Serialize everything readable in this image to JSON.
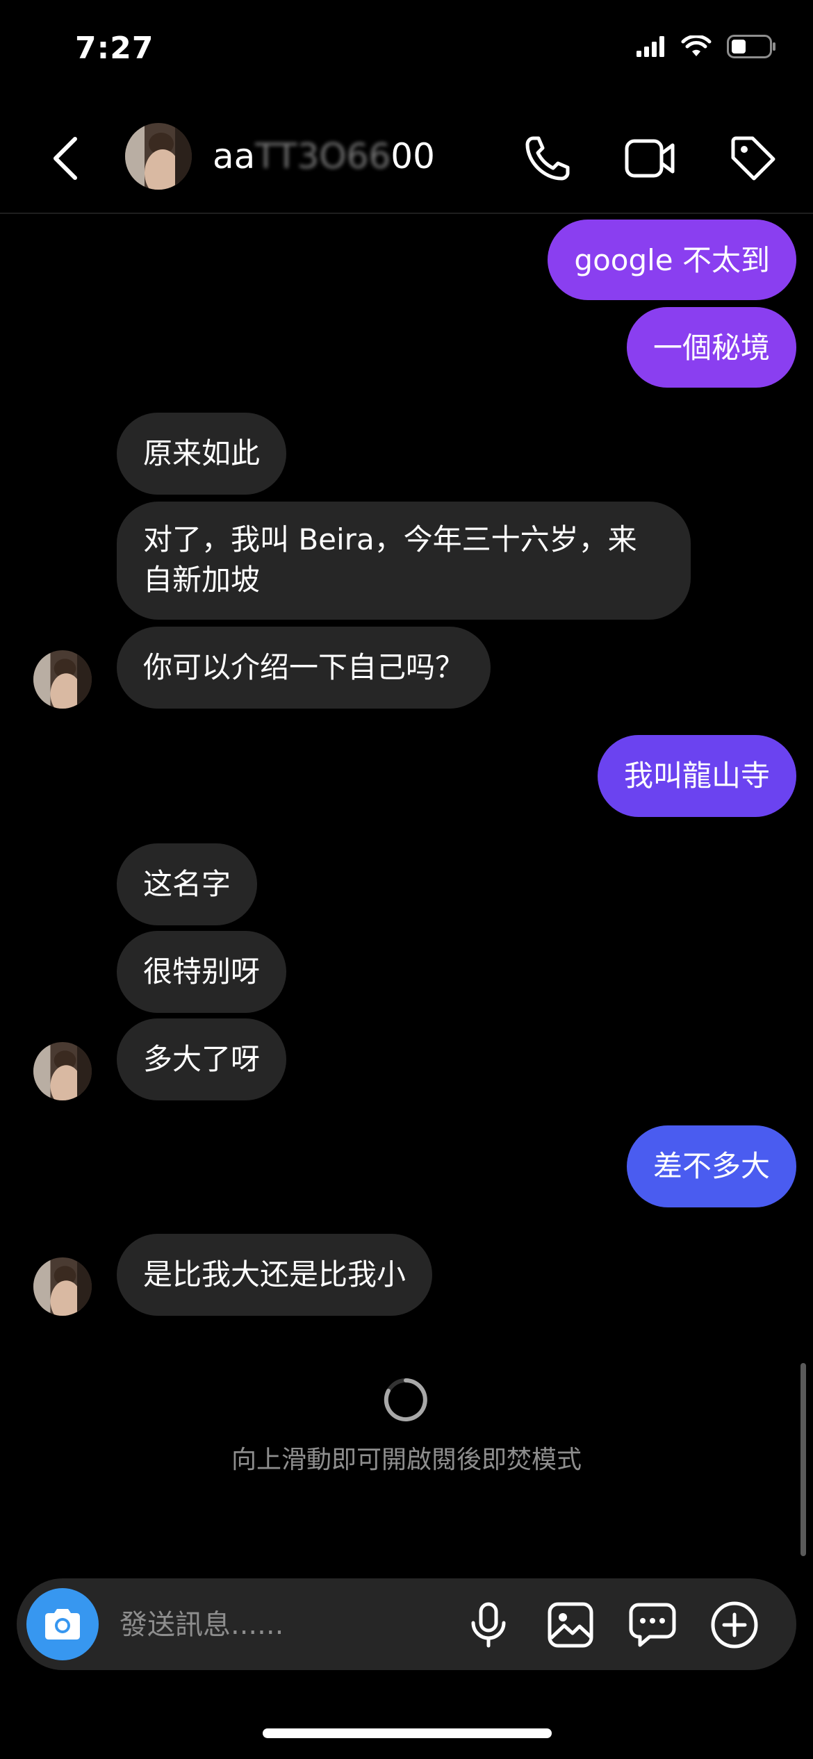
{
  "status": {
    "time": "7:27"
  },
  "header": {
    "name_visible_prefix": "aa",
    "name_obscured": "TT3O66",
    "name_visible_suffix": "00"
  },
  "messages": [
    {
      "side": "out",
      "text": "google 不太到",
      "color": "#8a3ff0"
    },
    {
      "side": "out",
      "text": "一個秘境",
      "color": "#8a3ff0"
    },
    {
      "side": "in",
      "text": "原来如此"
    },
    {
      "side": "in",
      "text": "对了，我叫 Beira，今年三十六岁，来自新加坡"
    },
    {
      "side": "in",
      "text": "你可以介绍一下自己吗？"
    },
    {
      "side": "out",
      "text": "我叫龍山寺",
      "color": "#6b43f0"
    },
    {
      "side": "in",
      "text": "这名字"
    },
    {
      "side": "in",
      "text": "很特别呀"
    },
    {
      "side": "in",
      "text": "多大了呀"
    },
    {
      "side": "out",
      "text": "差不多大",
      "color": "#4a5cf0"
    },
    {
      "side": "in",
      "text": "是比我大还是比我小"
    }
  ],
  "vanish_hint": "向上滑動即可開啟閱後即焚模式",
  "composer": {
    "placeholder": "發送訊息......"
  },
  "icons": {
    "back": "chevron-left-icon",
    "call": "phone-icon",
    "video": "video-camera-icon",
    "tag": "tag-icon",
    "camera": "camera-icon",
    "mic": "microphone-icon",
    "gallery": "image-icon",
    "sticker": "chat-bubble-icon",
    "add": "plus-circle-icon"
  }
}
